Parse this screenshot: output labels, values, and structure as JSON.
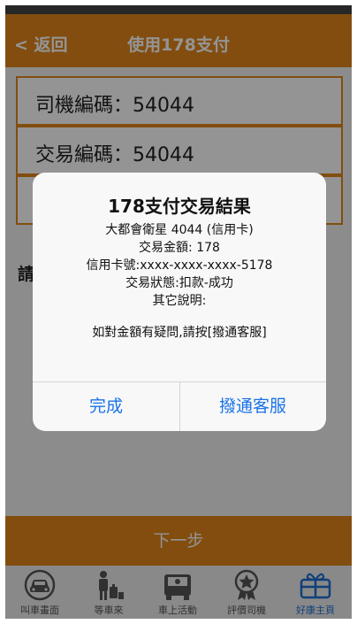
{
  "header": {
    "back_label": "< 返回",
    "title": "使用178支付"
  },
  "info": {
    "driver_code": "司機編碼：54044",
    "transaction_code": "交易編碼：54044",
    "third_row": ""
  },
  "prompt": {
    "partial_text": "請"
  },
  "footer": {
    "next_label": "下一步"
  },
  "tabbar": {
    "items": [
      {
        "label": "叫車畫面",
        "icon": "taxi-icon"
      },
      {
        "label": "等車來",
        "icon": "waiting-person-icon"
      },
      {
        "label": "車上活動",
        "icon": "in-car-icon"
      },
      {
        "label": "評價司機",
        "icon": "rating-medal-icon"
      },
      {
        "label": "好康主頁",
        "icon": "gift-icon"
      }
    ],
    "active_index": 4
  },
  "dialog": {
    "title": "178支付交易結果",
    "lines": [
      "大都會衛星 4044 (信用卡)",
      "交易金額: 178",
      "信用卡號:xxxx-xxxx-xxxx-5178",
      "交易狀態:扣款-成功",
      "其它說明:",
      "如對金額有疑問,請按[撥通客服]"
    ],
    "buttons": {
      "done": "完成",
      "call_service": "撥通客服"
    }
  },
  "colors": {
    "accent": "#e0851b",
    "dialog_button": "#1a73e8",
    "active_tab": "#1d6fd0"
  }
}
